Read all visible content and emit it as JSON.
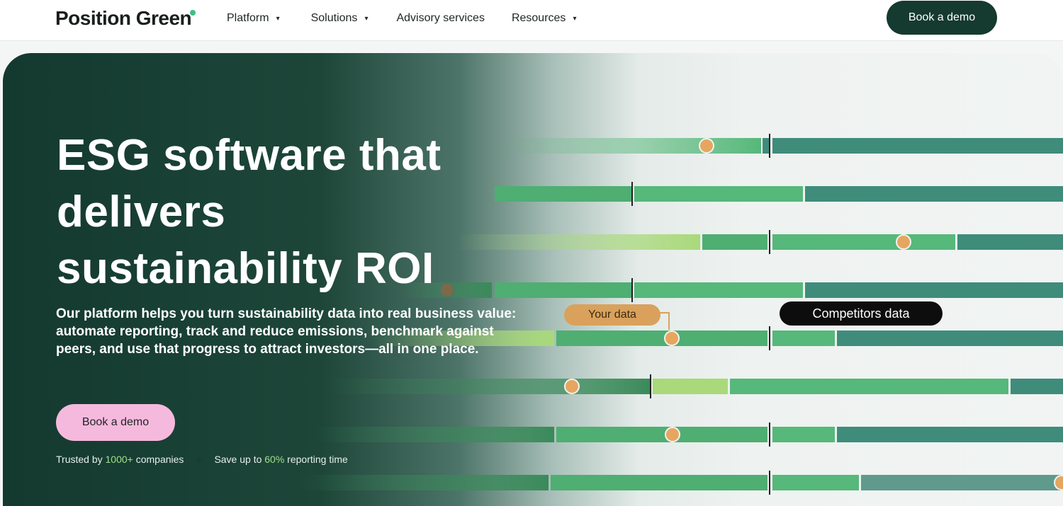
{
  "brand": {
    "name": "Position Green",
    "accent_color": "#3fbf7f"
  },
  "nav": {
    "items": [
      {
        "label": "Platform",
        "has_dropdown": true
      },
      {
        "label": "Solutions",
        "has_dropdown": true
      },
      {
        "label": "Advisory services",
        "has_dropdown": false
      },
      {
        "label": "Resources",
        "has_dropdown": true
      }
    ],
    "cta_label": "Book a demo",
    "caret_icon": "▾"
  },
  "hero": {
    "headline": "ESG software that delivers sustainability ROI",
    "subtext": "Our platform helps you turn sustainability data into real business value: automate reporting, track and reduce emissions, benchmark against peers, and use that progress to attract investors—all in one place.",
    "cta_label": "Book a demo",
    "trust": {
      "a_prefix": "Trusted by ",
      "a_value": "1000+",
      "a_suffix": " companies",
      "b_prefix": "Save up to ",
      "b_value": "60%",
      "b_suffix": " reporting time"
    },
    "labels": {
      "your_data": "Your data",
      "competitors_data": "Competitors data"
    },
    "colors": {
      "dark": "#153a30",
      "pink": "#f6b9de",
      "orange": "#e6a660",
      "teal": "#3f8c7b",
      "green": "#56b87a"
    }
  }
}
